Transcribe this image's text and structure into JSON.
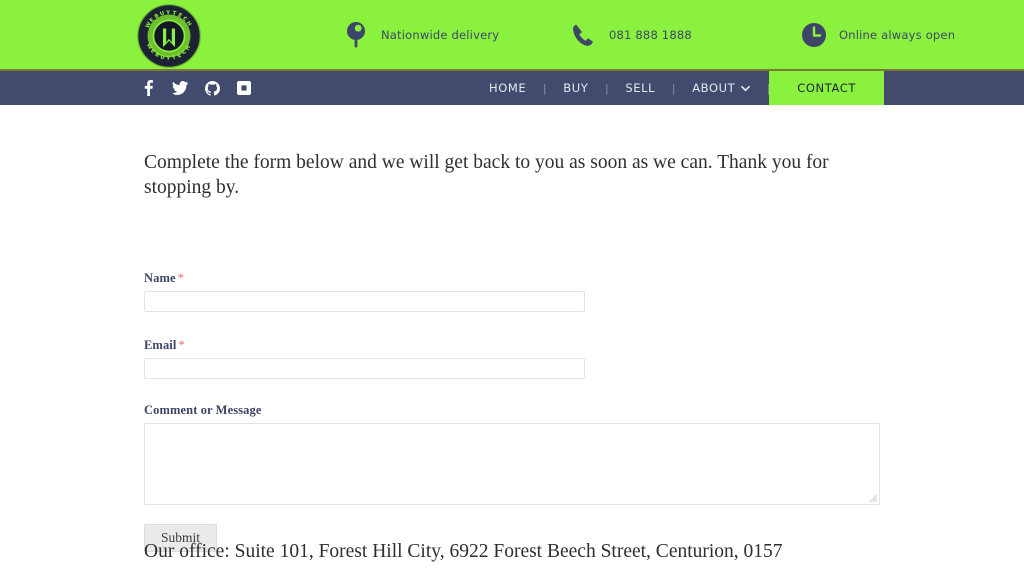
{
  "colors": {
    "brand_green": "#8af23f",
    "navy": "#424a6e",
    "nav_divider": "#7a7a35",
    "required_red": "#e8726f",
    "label_navy": "#3e4668",
    "body_text": "#2f2f2f"
  },
  "topbar": {
    "logo": {
      "name": "webuytech-logo",
      "outer_text": "WEBUYTECH",
      "inner_text": "WEBUYTECH",
      "monogram": "W"
    },
    "info_items": [
      {
        "icon": "map-pin-icon",
        "label": "Nationwide delivery"
      },
      {
        "icon": "phone-icon",
        "label": "081 888 1888"
      },
      {
        "icon": "clock-icon",
        "label": "Online always open"
      }
    ]
  },
  "navbar": {
    "social": [
      {
        "icon": "facebook-icon",
        "label": "Facebook"
      },
      {
        "icon": "twitter-icon",
        "label": "Twitter"
      },
      {
        "icon": "github-icon",
        "label": "GitHub"
      },
      {
        "icon": "dribbble-square-icon",
        "label": "Dribbble"
      }
    ],
    "separator": "|",
    "menu": [
      {
        "label": "HOME",
        "active": false,
        "has_dropdown": false
      },
      {
        "label": "BUY",
        "active": false,
        "has_dropdown": false
      },
      {
        "label": "SELL",
        "active": false,
        "has_dropdown": false
      },
      {
        "label": "ABOUT",
        "active": false,
        "has_dropdown": true
      },
      {
        "label": "CONTACT",
        "active": true,
        "has_dropdown": false
      }
    ]
  },
  "main": {
    "intro": "Complete the form below and we will get back to you as soon as we can. Thank you for stopping by.",
    "form": {
      "name_field": {
        "label": "Name",
        "required_marker": "*",
        "value": "",
        "placeholder": ""
      },
      "email_field": {
        "label": "Email",
        "required_marker": "*",
        "value": "",
        "placeholder": ""
      },
      "message_field": {
        "label": "Comment or Message",
        "value": "",
        "placeholder": ""
      },
      "submit_label": "Submit"
    },
    "office_address": "Our office: Suite 101, Forest Hill City, 6922 Forest Beech Street, Centurion, 0157"
  }
}
